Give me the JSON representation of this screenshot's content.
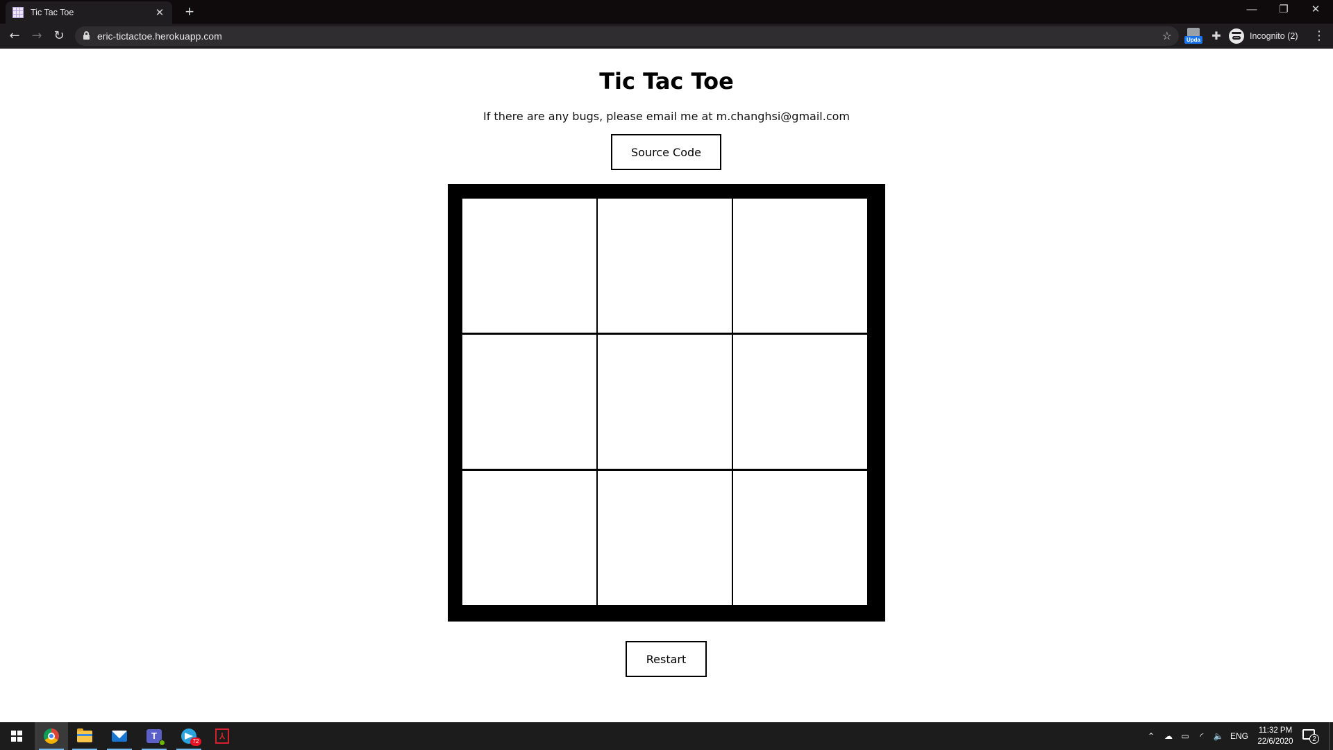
{
  "browser": {
    "tab_title": "Tic Tac Toe",
    "tab_close": "✕",
    "new_tab": "+",
    "url": "eric-tictactoe.herokuapp.com",
    "extension_badge": "Upda",
    "incognito_label": "Incognito (2)",
    "window_controls": {
      "minimize": "—",
      "restore": "❐",
      "close": "✕"
    }
  },
  "page": {
    "title": "Tic Tac Toe",
    "subtitle": "If there are any bugs, please email me at m.changhsi@gmail.com",
    "source_button": "Source Code",
    "restart_button": "Restart",
    "board": {
      "rows": [
        [
          "",
          "",
          ""
        ],
        [
          "",
          "",
          ""
        ],
        [
          "",
          "",
          ""
        ]
      ]
    }
  },
  "taskbar": {
    "apps": [
      "windows-start",
      "chrome",
      "file-explorer",
      "mail",
      "teams",
      "telegram",
      "acrobat"
    ],
    "telegram_badge": "72",
    "language": "ENG",
    "time": "11:32 PM",
    "date": "22/6/2020",
    "notification_count": "2"
  }
}
